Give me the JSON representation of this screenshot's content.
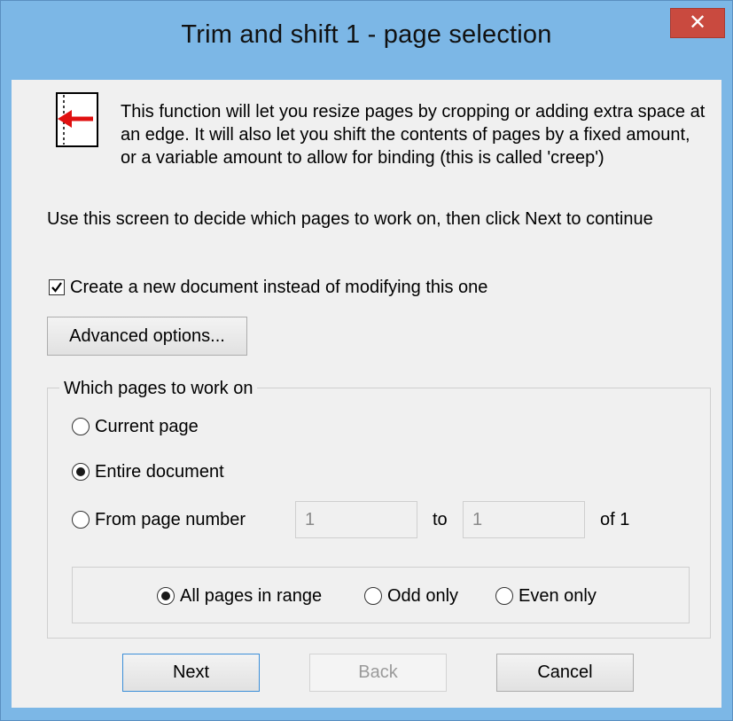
{
  "window": {
    "title": "Trim and shift 1 - page selection",
    "close_glyph": "✕"
  },
  "info": {
    "icon": "trim-shift-arrow-icon",
    "text": "This function will let you resize pages by cropping or adding extra space at an edge. It will also let you shift the contents of pages by a fixed amount, or a variable amount to allow for binding (this is called 'creep')"
  },
  "instructions": "Use this screen to decide which pages to work on, then click Next to continue",
  "new_document": {
    "label": "Create a new document instead of modifying this one",
    "checked": true
  },
  "advanced_button": "Advanced options...",
  "pages_group": {
    "legend": "Which pages to work on",
    "current_page": "Current page",
    "entire_document": "Entire document",
    "from_page": "From page number",
    "from_value": "1",
    "to_label": "to",
    "to_value": "1",
    "of_label": "of 1",
    "selected": "entire_document"
  },
  "parity": {
    "all": "All pages in range",
    "odd": "Odd only",
    "even": "Even only",
    "selected": "all"
  },
  "buttons": {
    "next": "Next",
    "back": "Back",
    "cancel": "Cancel"
  }
}
